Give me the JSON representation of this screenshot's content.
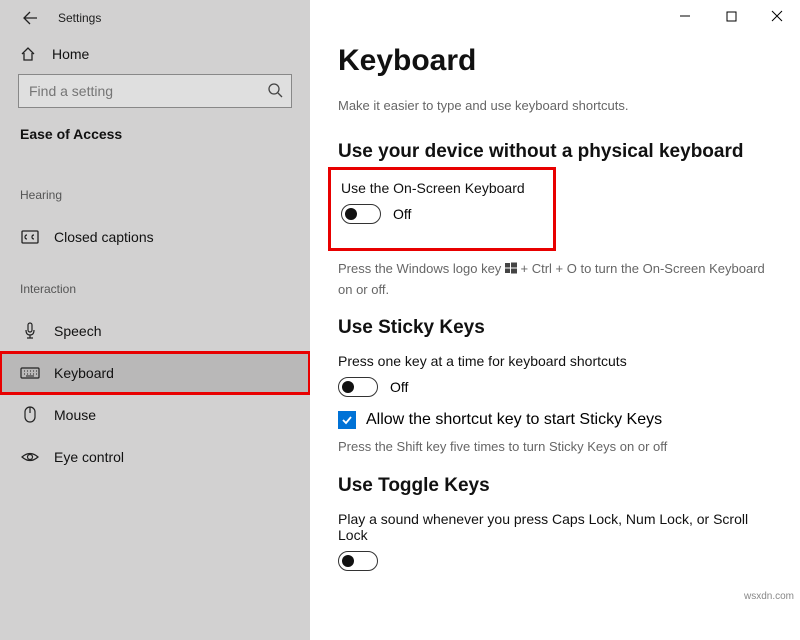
{
  "titlebar": {
    "title": "Settings"
  },
  "sidebar": {
    "home_label": "Home",
    "search_placeholder": "Find a setting",
    "category": "Ease of Access",
    "groups": {
      "hearing": "Hearing",
      "interaction": "Interaction"
    },
    "items": {
      "closed_captions": "Closed captions",
      "speech": "Speech",
      "keyboard": "Keyboard",
      "mouse": "Mouse",
      "eye_control": "Eye control"
    }
  },
  "main": {
    "heading": "Keyboard",
    "subtext": "Make it easier to type and use keyboard shortcuts.",
    "section1": {
      "title": "Use your device without a physical keyboard",
      "toggle_label": "Use the On-Screen Keyboard",
      "toggle_state": "Off",
      "hint_pre": "Press the Windows logo key ",
      "hint_post": " + Ctrl + O to turn the On-Screen Keyboard on or off."
    },
    "section2": {
      "title": "Use Sticky Keys",
      "label": "Press one key at a time for keyboard shortcuts",
      "toggle_state": "Off",
      "checkbox_label": "Allow the shortcut key to start Sticky Keys",
      "hint": "Press the Shift key five times to turn Sticky Keys on or off"
    },
    "section3": {
      "title": "Use Toggle Keys",
      "label": "Play a sound whenever you press Caps Lock, Num Lock, or Scroll Lock"
    }
  },
  "watermark": "wsxdn.com"
}
